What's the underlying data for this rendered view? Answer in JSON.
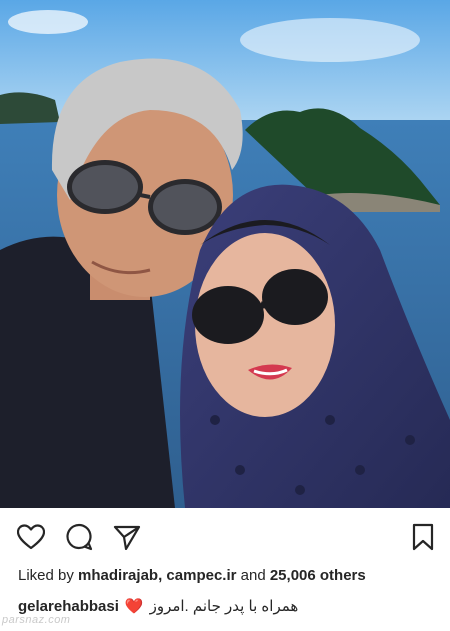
{
  "post": {
    "photo_icon": "selfie-photo",
    "likes": {
      "prefix": "Liked by",
      "user1": "mhadirajab,",
      "user2": "campec.ir",
      "and": "and",
      "count": "25,006 others"
    },
    "caption": {
      "username": "gelarehabbasi",
      "text": "همراه با پدر جانم .امروز",
      "emoji": "❤️"
    }
  },
  "icons": {
    "like": "heart-outline-icon",
    "comment": "comment-bubble-icon",
    "share": "paper-plane-icon",
    "save": "bookmark-icon"
  },
  "watermark": "parsnaz.com"
}
